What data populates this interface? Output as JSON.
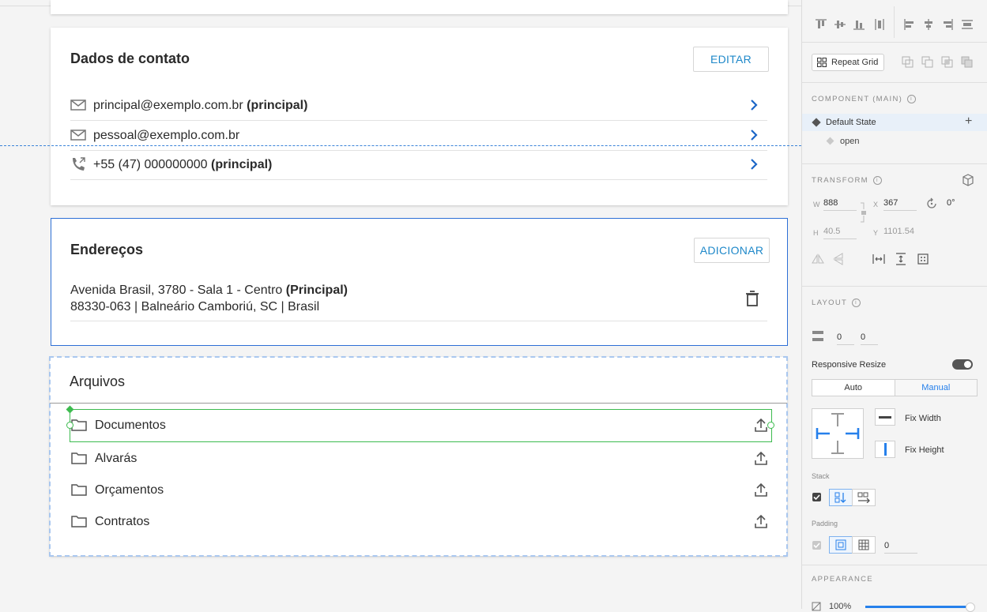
{
  "contact": {
    "title": "Dados de contato",
    "edit_label": "EDITAR",
    "items": [
      {
        "text": "principal@exemplo.com.br",
        "tag": "(principal)",
        "icon": "mail-icon"
      },
      {
        "text": "pessoal@exemplo.com.br",
        "tag": "",
        "icon": "mail-icon"
      },
      {
        "text": "+55 (47) 000000000",
        "tag": "(principal)",
        "icon": "phone-icon"
      }
    ]
  },
  "addresses": {
    "title": "Endereços",
    "add_label": "ADICIONAR",
    "line1": "Avenida Brasil, 3780 - Sala 1 - Centro",
    "line1_tag": "(Principal)",
    "line2": "88330-063 | Balneário Camboriú, SC | Brasil"
  },
  "files": {
    "title": "Arquivos",
    "folders": [
      "Documentos",
      "Alvarás",
      "Orçamentos",
      "Contratos"
    ]
  },
  "panel": {
    "repeat_grid": "Repeat Grid",
    "component_title": "COMPONENT (MAIN)",
    "default_state": "Default State",
    "state_open": "open",
    "transform_title": "TRANSFORM",
    "w_label": "W",
    "w_value": "888",
    "x_label": "X",
    "x_value": "367",
    "rotation": "0°",
    "h_label": "H",
    "h_value": "40.5",
    "y_label": "Y",
    "y_value": "1101.54",
    "layout_title": "LAYOUT",
    "layout_v1": "0",
    "layout_v2": "0",
    "responsive_resize": "Responsive Resize",
    "responsive_on": true,
    "auto_label": "Auto",
    "manual_label": "Manual",
    "fix_width": "Fix Width",
    "fix_height": "Fix Height",
    "stack_label": "Stack",
    "padding_label": "Padding",
    "padding_value": "0",
    "appearance_title": "APPEARANCE",
    "opacity": "100%"
  },
  "colors": {
    "accent_blue": "#1e88c9",
    "selection_green": "#3dbb4f",
    "xd_blue": "#2680eb"
  }
}
